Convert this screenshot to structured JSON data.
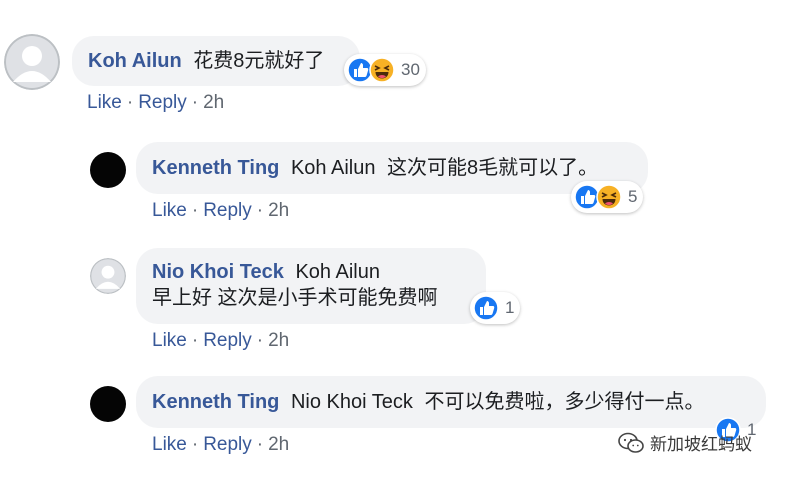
{
  "comments": [
    {
      "author": "Koh Ailun",
      "text": "花费8元就好了",
      "reaction_count": "30",
      "reactions": [
        "like-icon",
        "haha-icon"
      ],
      "avatar": "default-gray",
      "actions": {
        "like": "Like",
        "reply": "Reply",
        "time": "2h"
      }
    },
    {
      "author": "Kenneth Ting",
      "mention": "Koh Ailun",
      "text": "这次可能8毛就可以了。",
      "reaction_count": "5",
      "reactions": [
        "like-icon",
        "haha-icon"
      ],
      "avatar": "black",
      "actions": {
        "like": "Like",
        "reply": "Reply",
        "time": "2h"
      }
    },
    {
      "author": "Nio Khoi Teck",
      "mention": "Koh Ailun",
      "text": "早上好 这次是小手术可能免费啊",
      "reaction_count": "1",
      "reactions": [
        "like-icon"
      ],
      "avatar": "default-gray",
      "actions": {
        "like": "Like",
        "reply": "Reply",
        "time": "2h"
      }
    },
    {
      "author": "Kenneth Ting",
      "mention": "Nio Khoi Teck",
      "text": "不可以免费啦，多少得付一点。",
      "reaction_count": "1",
      "reactions": [
        "like-icon"
      ],
      "avatar": "black",
      "actions": {
        "like": "Like",
        "reply": "Reply",
        "time": "2h"
      }
    }
  ],
  "separator": "·",
  "watermark": {
    "text": "新加坡红蚂蚁",
    "icon": "wechat-icon"
  },
  "colors": {
    "name": "#385898",
    "bubble": "#f2f3f5",
    "like": "#1877f2",
    "haha": "#f7b125",
    "meta": "#606770"
  }
}
